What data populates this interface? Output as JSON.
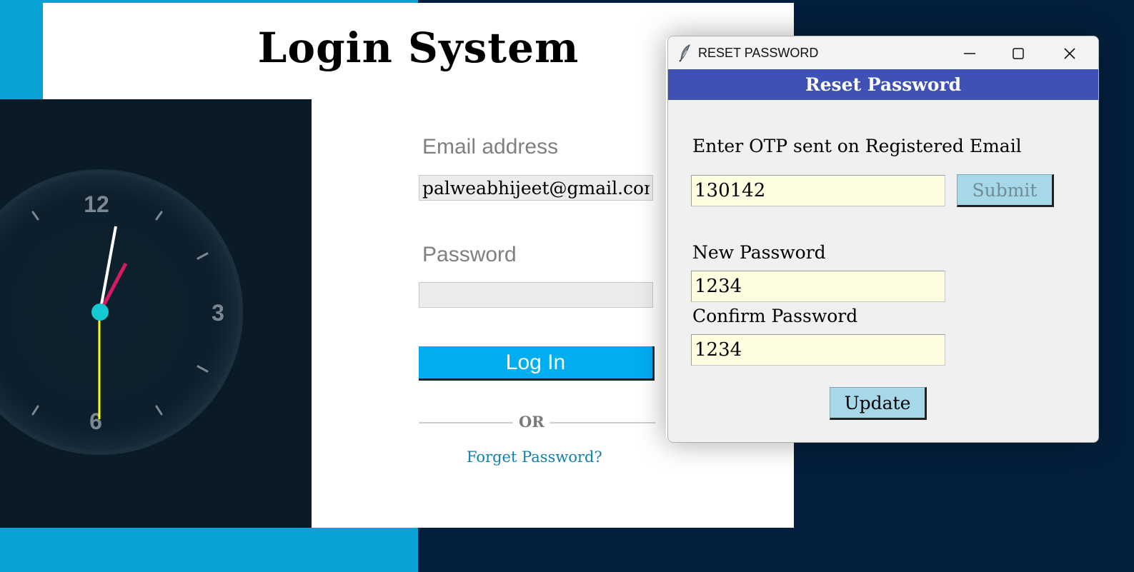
{
  "login": {
    "title": "Login System",
    "email_label": "Email address",
    "email_value": "palweabhijeet@gmail.com",
    "password_label": "Password",
    "password_value": "",
    "login_button": "Log In",
    "or_text": "OR",
    "forget_link": "Forget Password?"
  },
  "clock": {
    "numbers": [
      "12",
      "3",
      "6"
    ],
    "hand_colors": {
      "hour": "#ffffff",
      "minute": "#d81b60",
      "second": "#ffff00",
      "center": "#14c8d4"
    }
  },
  "dialog": {
    "window_title": "RESET PASSWORD",
    "header": "Reset Password",
    "otp_label": "Enter OTP sent on Registered Email",
    "otp_value": "130142",
    "submit_button": "Submit",
    "new_password_label": "New Password",
    "new_password_value": "1234",
    "confirm_password_label": "Confirm Password",
    "confirm_password_value": "1234",
    "update_button": "Update",
    "window_controls": {
      "minimize_icon": "minimize-icon",
      "maximize_icon": "maximize-icon",
      "close_icon": "close-icon"
    }
  },
  "colors": {
    "cyan_background": "#08a3d4",
    "navy_background": "#041f3d",
    "login_button": "#00adef",
    "dialog_header": "#3f51b5",
    "input_fill": "#fffde0",
    "dialog_button": "#a6d8ea"
  }
}
